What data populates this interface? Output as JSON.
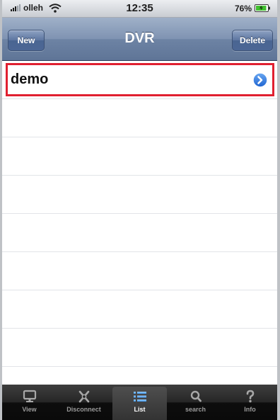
{
  "status_bar": {
    "carrier": "olleh",
    "time": "12:35",
    "battery": "76%"
  },
  "nav": {
    "title": "DVR",
    "new_label": "New",
    "delete_label": "Delete"
  },
  "list": {
    "items": [
      {
        "label": "demo"
      }
    ]
  },
  "tabbar": {
    "tabs": [
      {
        "label": "View",
        "icon": "monitor-icon"
      },
      {
        "label": "Disconnect",
        "icon": "disconnect-icon"
      },
      {
        "label": "List",
        "icon": "list-icon"
      },
      {
        "label": "search",
        "icon": "search-icon"
      },
      {
        "label": "Info",
        "icon": "info-icon"
      }
    ],
    "selected": "List"
  },
  "colors": {
    "nav_bar": "#7489aa",
    "selection_border": "#e02030",
    "disclosure": "#2f7be0",
    "tab_bar": "#1a1a1a"
  }
}
